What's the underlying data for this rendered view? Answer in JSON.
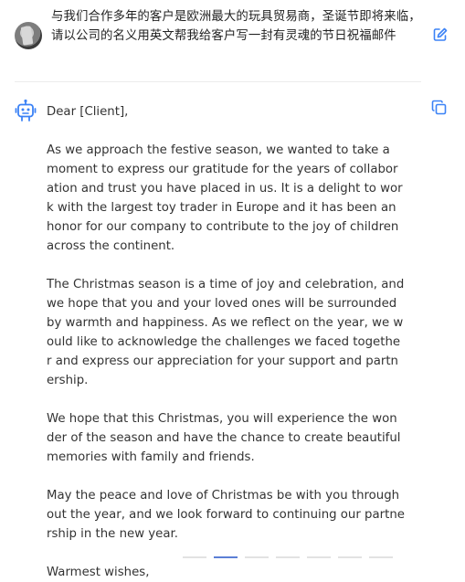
{
  "user_message": {
    "text": "与我们合作多年的客户是欧洲最大的玩具贸易商，圣诞节即将来临，请以公司的名义用英文帮我给客户写一封有灵魂的节日祝福邮件"
  },
  "icons": {
    "avatar": "user-avatar",
    "edit": "edit-icon",
    "bot": "robot-icon",
    "copy": "copy-icon"
  },
  "reply": {
    "greeting": "Dear [Client],",
    "paragraphs": [
      "As we approach the festive season, we wanted to take a moment to express our gratitude for the years of collaboration and trust you have placed in us. It is a delight to work with the largest toy trader in Europe and it has been an honor for our company to contribute to the joy of children across the continent.",
      "The Christmas season is a time of joy and celebration, and we hope that you and your loved ones will be surrounded by warmth and happiness. As we reflect on the year, we would like to acknowledge the challenges we faced together and express our appreciation for your support and partnership.",
      "We hope that this Christmas, you will experience the wonder of the season and have the chance to create beautiful memories with family and friends.",
      "May the peace and love of Christmas be with you throughout the year, and we look forward to continuing our partnership in the new year."
    ],
    "closing": "Warmest wishes,"
  },
  "colors": {
    "accent": "#3b82f6",
    "text": "#333333"
  }
}
